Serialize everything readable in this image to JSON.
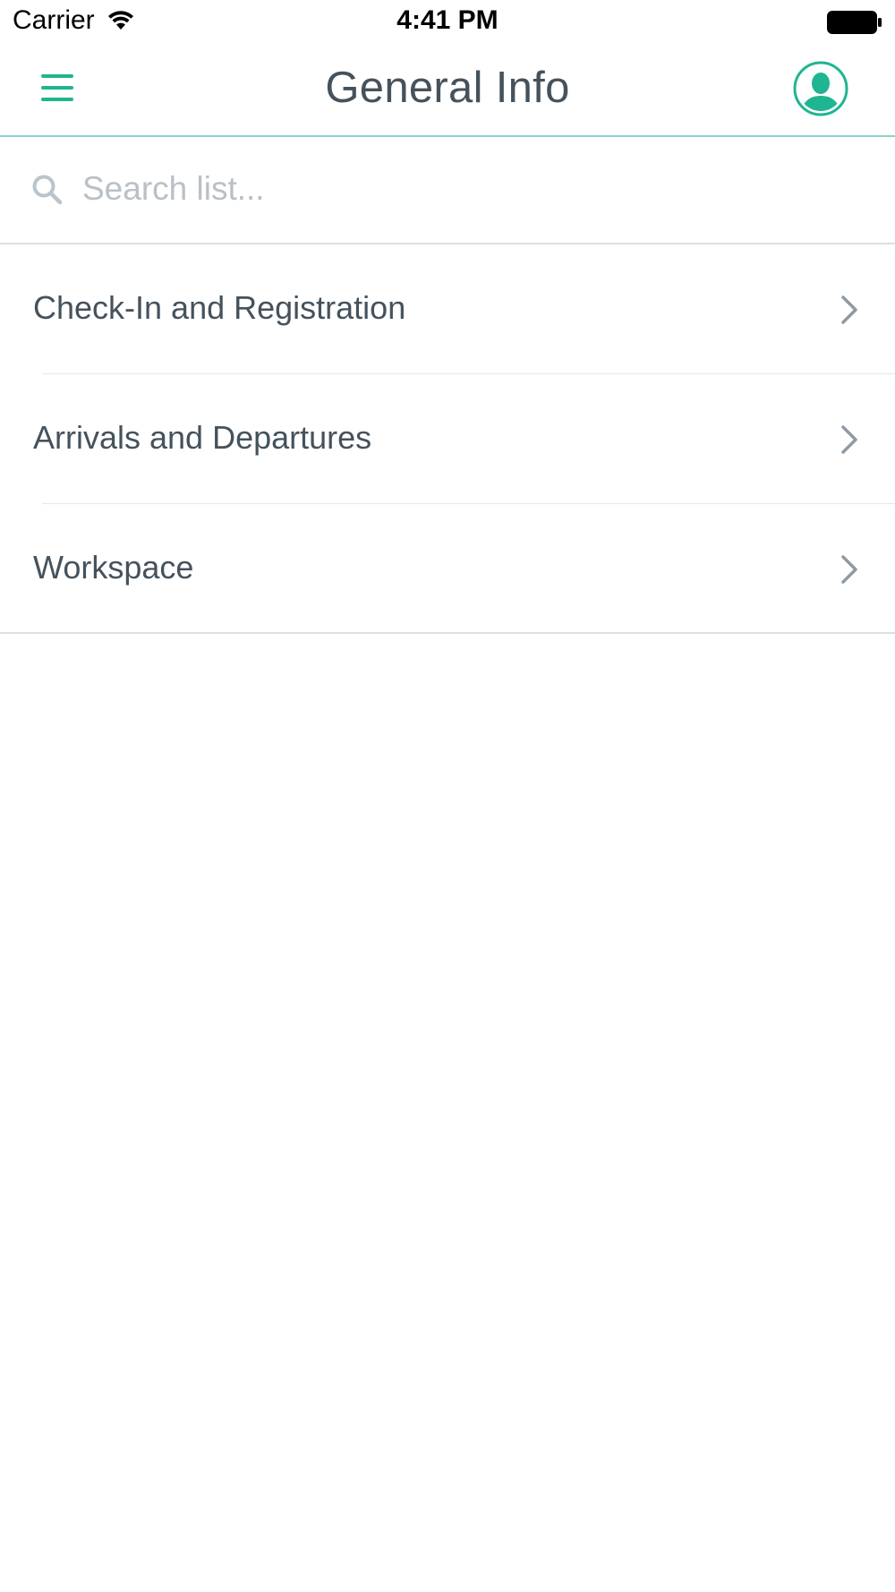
{
  "status_bar": {
    "carrier": "Carrier",
    "time": "4:41 PM",
    "icons": [
      "wifi-icon",
      "battery-icon"
    ]
  },
  "nav": {
    "title": "General Info",
    "menu_icon": "hamburger-menu-icon",
    "profile_icon": "user-avatar-icon",
    "accent_color": "#1fb590"
  },
  "search": {
    "placeholder": "Search list...",
    "value": "",
    "icon": "search-icon"
  },
  "list": {
    "items": [
      {
        "label": "Check-In and Registration"
      },
      {
        "label": "Arrivals and Departures"
      },
      {
        "label": "Workspace"
      }
    ],
    "chevron_icon": "chevron-right-icon"
  }
}
